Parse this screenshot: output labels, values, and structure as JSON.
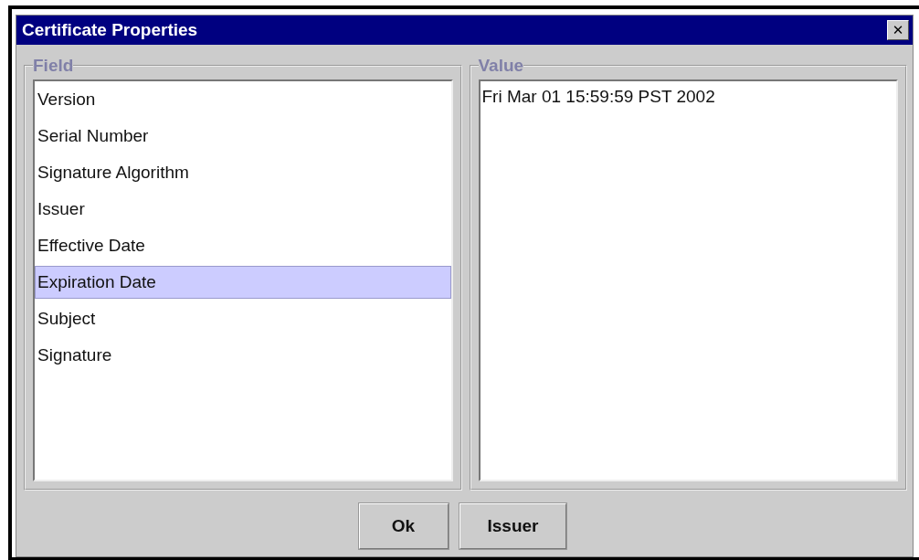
{
  "window": {
    "title": "Certificate Properties",
    "close": "✕"
  },
  "field_group": {
    "title": "Field",
    "items": [
      {
        "label": "Version",
        "selected": false
      },
      {
        "label": "Serial Number",
        "selected": false
      },
      {
        "label": "Signature Algorithm",
        "selected": false
      },
      {
        "label": "Issuer",
        "selected": false
      },
      {
        "label": "Effective Date",
        "selected": false
      },
      {
        "label": "Expiration Date",
        "selected": true
      },
      {
        "label": "Subject",
        "selected": false
      },
      {
        "label": "Signature",
        "selected": false
      }
    ]
  },
  "value_group": {
    "title": "Value",
    "text": "Fri Mar 01 15:59:59 PST 2002"
  },
  "buttons": [
    "Ok",
    "Issuer"
  ]
}
